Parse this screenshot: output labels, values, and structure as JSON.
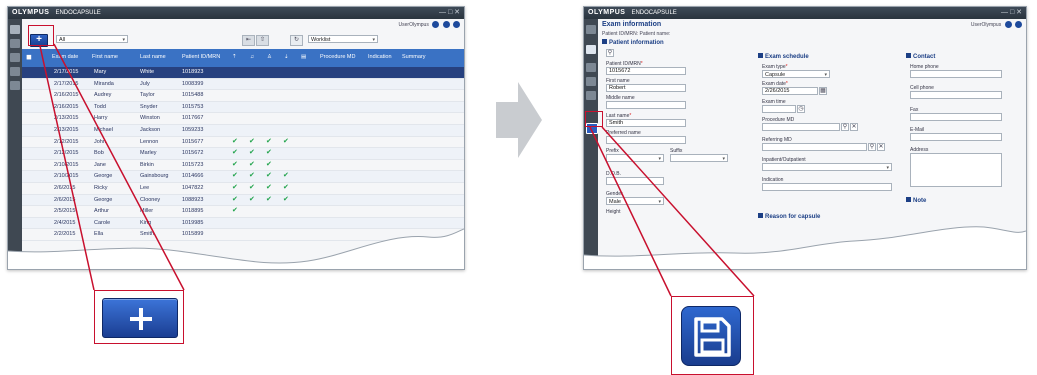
{
  "app": {
    "brand": "OLYMPUS",
    "name": "ENDOCAPSULE",
    "user": "UserOlympus"
  },
  "list_view": {
    "filter_value": "All",
    "worklist_select": "Worklist",
    "columns": [
      "Exam date",
      "First name",
      "Last name",
      "Patient ID/MRN",
      "Procedure MD",
      "Indication",
      "Summary"
    ],
    "rows": [
      {
        "date": "2/17/2015",
        "first": "Mary",
        "last": "White",
        "id": "1018923",
        "checks": 0
      },
      {
        "date": "2/17/2015",
        "first": "Miranda",
        "last": "July",
        "id": "1008399",
        "checks": 0
      },
      {
        "date": "2/16/2015",
        "first": "Audrey",
        "last": "Taylor",
        "id": "1015488",
        "checks": 0
      },
      {
        "date": "2/16/2015",
        "first": "Todd",
        "last": "Snyder",
        "id": "1015753",
        "checks": 0
      },
      {
        "date": "2/13/2015",
        "first": "Harry",
        "last": "Winston",
        "id": "1017667",
        "checks": 0
      },
      {
        "date": "2/13/2015",
        "first": "Michael",
        "last": "Jackson",
        "id": "1059233",
        "checks": 0
      },
      {
        "date": "2/12/2015",
        "first": "John",
        "last": "Lennon",
        "id": "1015677",
        "checks": 4
      },
      {
        "date": "2/12/2015",
        "first": "Bob",
        "last": "Marley",
        "id": "1015672",
        "checks": 3
      },
      {
        "date": "2/10/2015",
        "first": "Jane",
        "last": "Birkin",
        "id": "1015723",
        "checks": 3
      },
      {
        "date": "2/10/2015",
        "first": "George",
        "last": "Gainsbourg",
        "id": "1014666",
        "checks": 4
      },
      {
        "date": "2/6/2015",
        "first": "Ricky",
        "last": "Lee",
        "id": "1047822",
        "checks": 4
      },
      {
        "date": "2/6/2015",
        "first": "George",
        "last": "Clooney",
        "id": "1088923",
        "checks": 4
      },
      {
        "date": "2/5/2015",
        "first": "Arthur",
        "last": "Miller",
        "id": "1018895",
        "checks": 1
      },
      {
        "date": "2/4/2015",
        "first": "Carole",
        "last": "King",
        "id": "1019985",
        "checks": 0
      },
      {
        "date": "2/2/2015",
        "first": "Ella",
        "last": "Smith",
        "id": "1015899",
        "checks": 0
      }
    ]
  },
  "exam_view": {
    "title": "Exam information",
    "sub_info": "Patient ID/MRN:    Patient name:",
    "patient_section": "Patient information",
    "schedule_section": "Exam schedule",
    "contact_section": "Contact",
    "note_section": "Note",
    "reason_section": "Reason for capsule",
    "patient_id_label": "Patient ID/MRN",
    "patient_id_value": "1015672",
    "first_name_label": "First name",
    "first_name_value": "Robert",
    "middle_name_label": "Middle name",
    "last_name_label": "Last name",
    "last_name_value": "Smith",
    "preferred_name_label": "Preferred name",
    "prefix_label": "Prefix",
    "suffix_label": "Suffix",
    "dob_label": "D.O.B.",
    "gender_label": "Gender",
    "gender_value": "Male",
    "height_label": "Height",
    "exam_type_label": "Exam type",
    "exam_type_value": "Capsule",
    "exam_date_label": "Exam date",
    "exam_date_value": "2/26/2015",
    "exam_time_label": "Exam time",
    "procedure_md_label": "Procedure MD",
    "referring_md_label": "Referring MD",
    "inpatient_label": "Inpatient/Outpatient",
    "indication_label": "Indication",
    "home_phone_label": "Home phone",
    "cell_phone_label": "Cell phone",
    "fax_label": "Fax",
    "email_label": "E-Mail",
    "address_label": "Address"
  },
  "colors": {
    "accent": "#1c3f85",
    "header_blue": "#3a72c4",
    "callout_red": "#c8102e",
    "check_green": "#21a34b"
  },
  "icons": [
    "plus-icon",
    "save-icon",
    "search-icon",
    "clear-icon",
    "calendar-icon",
    "clock-icon",
    "arrow-right-icon"
  ]
}
